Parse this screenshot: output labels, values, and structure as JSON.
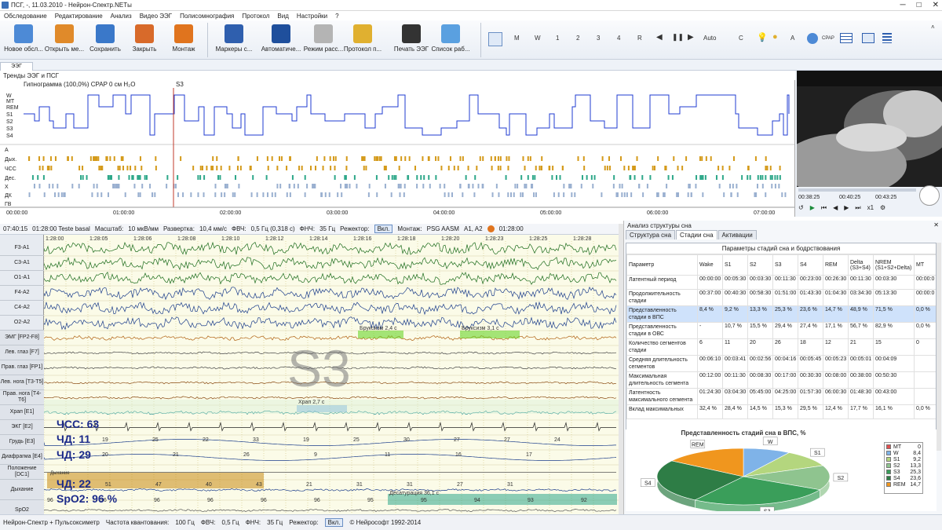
{
  "window": {
    "title": "ПСГ, -, 11.03.2010 - Нейрон-Спектр.NETы"
  },
  "menu": [
    "Обследование",
    "Редактирование",
    "Анализ",
    "Видео ЭЭГ",
    "Полисомнография",
    "Протокол",
    "Вид",
    "Настройки",
    "?"
  ],
  "toolbar": {
    "buttons": [
      {
        "label": "Новое обсл...",
        "icon": "new-exam-icon",
        "color": "#4d8ad6"
      },
      {
        "label": "Открыть ме...",
        "icon": "open-icon",
        "color": "#e08a2a"
      },
      {
        "label": "Сохранить",
        "icon": "save-icon",
        "color": "#3a78c9"
      },
      {
        "label": "Закрыть",
        "icon": "close-exam-icon",
        "color": "#d86a2a"
      },
      {
        "label": "Монтаж",
        "icon": "montage-icon",
        "color": "#e0741e"
      },
      {
        "label": "Маркеры с...",
        "icon": "markers-icon",
        "color": "#2f5fae"
      },
      {
        "label": "Автоматиче...",
        "icon": "auto-analysis-icon",
        "color": "#1f4f9c"
      },
      {
        "label": "Режим расс...",
        "icon": "review-mode-icon",
        "color": "#b4b4b4"
      },
      {
        "label": "Протокол п...",
        "icon": "protocol-icon",
        "color": "#e0b030"
      },
      {
        "label": "Печать ЭЭГ",
        "icon": "print-icon",
        "color": "#333333"
      },
      {
        "label": "Список раб...",
        "icon": "worklist-icon",
        "color": "#5aa0e0"
      }
    ],
    "small": [
      "M",
      "W",
      "1",
      "2",
      "3",
      "4",
      "R",
      "Auto",
      "C",
      "A",
      "CPAP"
    ]
  },
  "panel": {
    "tab": "ЭЭГ",
    "header": "Тренды ЭЭГ и ПСГ"
  },
  "trends": {
    "title": "Гипнограмма  (100,0%)  CPAP 0 см H₂O",
    "marker": "S3",
    "stages": [
      "W",
      "MT",
      "REM",
      "S1",
      "S2",
      "S3",
      "S4"
    ],
    "event_rows": [
      "А",
      "Дых.",
      "ЧСС",
      "Дес.",
      "Х",
      "ДК",
      "ГВ"
    ],
    "time_ticks": [
      "00:00:00",
      "01:00:00",
      "02:00:00",
      "03:00:00",
      "04:00:00",
      "05:00:00",
      "06:00:00",
      "07:00:00"
    ]
  },
  "video": {
    "time_start": "00:38:25",
    "time_mid": "00:40:25",
    "time_end": "00:43:25",
    "speed": "x1"
  },
  "controls": {
    "time": "07:40:15",
    "patient": "01:28:00 Teste basal",
    "scale_label": "Масштаб:",
    "scale": "10 мкВ/мм",
    "sweep_label": "Развертка:",
    "sweep": "10,4 мм/с",
    "hf_label": "ФВЧ:",
    "hf": "0,5 Гц (0,318 с)",
    "lf_label": "ФНЧ:",
    "lf": "35 Гц",
    "notch_label": "Режектор:",
    "notch": "Вкл.",
    "montage_label": "Монтаж:",
    "montage": "PSG AASM",
    "ref": "A1, A2",
    "clock": "01:28:00"
  },
  "eeg": {
    "times": [
      "1:28:00",
      "1:28:05",
      "1:28:06",
      "1:28:08",
      "1:28:10",
      "1:28:12",
      "1:28:14",
      "1:28:16",
      "1:28:18",
      "1:28:20",
      "1:28:23",
      "1:28:25",
      "1:28:28"
    ],
    "channels": [
      "F3-A1",
      "C3-A1",
      "O1-A1",
      "F4-A2",
      "C4-A2",
      "O2-A2",
      "ЭМГ [FP2-F8]",
      "Лев. глаз [F7]",
      "Прав. глаз [FP1]",
      "Лев. нога [T3-T5]",
      "Прав. нога [T4-T6]",
      "Храп [E1]",
      "ЭКГ [E2]",
      "Грудь [E3]",
      "Диафрагма [E4]",
      "Положение [DC1]",
      "Дыхание",
      "SpO2"
    ],
    "stage_label": "S3",
    "events": [
      "Бруксизм 2,4 с",
      "Бруксизм 3,1 с",
      "Храп 2,7 с",
      "Десатурация 36,1 с"
    ],
    "hr": "ЧСС: 63",
    "rr1": "ЧД: 11",
    "rr2": "ЧД: 29",
    "rr3": "ЧД: 22",
    "spo2": "SpO2: 96 %",
    "rr_values1": [
      "19",
      "25",
      "22",
      "33",
      "19",
      "25",
      "30",
      "27",
      "27",
      "24"
    ],
    "rr_values2": [
      "20",
      "21",
      "26",
      "9",
      "11",
      "16",
      "17"
    ],
    "breath_values": [
      "51",
      "47",
      "40",
      "43",
      "21",
      "31",
      "31",
      "27",
      "31"
    ],
    "spo2_values": [
      "96",
      "96",
      "96",
      "96",
      "96",
      "96",
      "95",
      "95",
      "94",
      "93",
      "92"
    ],
    "resp_tag": "Дыхание"
  },
  "analysis": {
    "title": "Анализ структуры сна",
    "tabs": [
      "Структура сна",
      "Стадии сна",
      "Активации"
    ],
    "table_title": "Параметры стадий сна и бодрствования",
    "columns": [
      "Параметр",
      "Wake",
      "S1",
      "S2",
      "S3",
      "S4",
      "REM",
      "Delta (S3+S4)",
      "NREM (S1+S2+Delta)",
      "MT"
    ],
    "rows": [
      [
        "Латентный период",
        "00:00:00",
        "00:05:30",
        "00:03:30",
        "00:11:30",
        "00:23:00",
        "00:26:30",
        "00:11:30",
        "00:03:30",
        "00:00:0"
      ],
      [
        "Продолжительность стадии",
        "00:37:00",
        "00:40:30",
        "00:58:30",
        "01:51:00",
        "01:43:30",
        "01:04:30",
        "03:34:30",
        "05:13:30",
        "00:00:0"
      ],
      [
        "Представленность стадии в ВПС",
        "8,4 %",
        "9,2 %",
        "13,3 %",
        "25,3 %",
        "23,6 %",
        "14,7 %",
        "48,9 %",
        "71,5 %",
        "0,0 %"
      ],
      [
        "Представленность стадии в ОВС",
        "-",
        "10,7 %",
        "15,5 %",
        "29,4 %",
        "27,4 %",
        "17,1 %",
        "56,7 %",
        "82,9 %",
        "0,0 %"
      ],
      [
        "Количество сегментов стадии",
        "6",
        "11",
        "20",
        "26",
        "18",
        "12",
        "21",
        "15",
        "0"
      ],
      [
        "Средняя длительность сегментов",
        "00:06:10",
        "00:03:41",
        "00:02:56",
        "00:04:16",
        "00:05:45",
        "00:05:23",
        "00:05:01",
        "00:04:09",
        ""
      ],
      [
        "Максимальная длительность сегмента",
        "00:12:00",
        "00:11:30",
        "00:08:30",
        "00:17:00",
        "00:30:30",
        "00:08:00",
        "00:38:00",
        "00:50:30",
        ""
      ],
      [
        "Латентность максимального сегмента",
        "01:24:30",
        "03:04:30",
        "05:45:00",
        "04:25:00",
        "01:57:30",
        "06:00:30",
        "01:48:30",
        "00:43:00",
        ""
      ],
      [
        "Вклад максимальных",
        "32,4 %",
        "28,4 %",
        "14,5 %",
        "15,3 %",
        "29,5 %",
        "12,4 %",
        "17,7 %",
        "16,1 %",
        "0,0 %"
      ]
    ],
    "highlight_row": 2,
    "pie_title": "Представленность стадий сна в ВПС, %",
    "pie_labels": [
      "S3",
      "S2",
      "S1",
      "W",
      "MT",
      "REM",
      "S4"
    ]
  },
  "chart_data": {
    "type": "pie",
    "title": "Представленность стадий сна в ВПС, %",
    "categories": [
      "MT",
      "W",
      "S1",
      "S2",
      "S3",
      "S4",
      "REM"
    ],
    "values": [
      0,
      8.4,
      9.2,
      13.3,
      25.3,
      23.6,
      14.7
    ],
    "colors": [
      "#e05050",
      "#7fb3e8",
      "#b4d67e",
      "#8fc48f",
      "#3a9e5a",
      "#2e7d46",
      "#f0961e"
    ]
  },
  "status": {
    "device": "Нейрон-Спектр + Пульсоксиметр",
    "rate_label": "Частота квантования:",
    "rate": "100 Гц",
    "hf_label": "ФВЧ:",
    "hf": "0,5 Гц",
    "lf_label": "ФНЧ:",
    "lf": "35 Гц",
    "notch_label": "Режектор:",
    "notch": "Вкл.",
    "copyright": "© Нейрософт 1992-2014"
  }
}
